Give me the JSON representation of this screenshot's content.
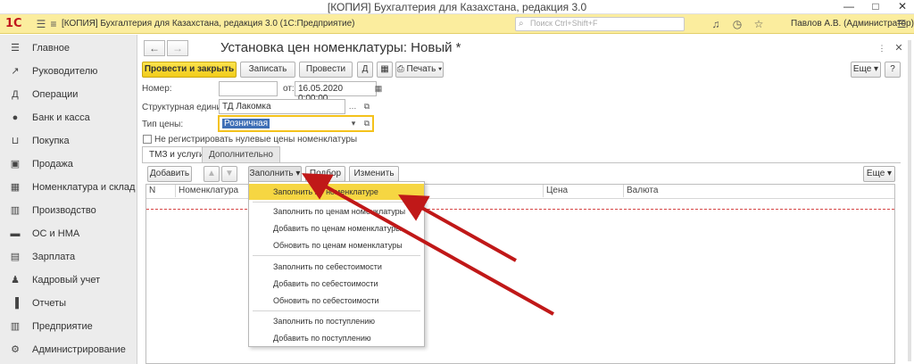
{
  "window": {
    "title": "[КОПИЯ] Бухгалтерия для Казахстана, редакция 3.0",
    "controls": [
      "—",
      "□",
      "✕"
    ]
  },
  "header": {
    "logo": "1С",
    "doc_title": "[КОПИЯ] Бухгалтерия для Казахстана, редакция 3.0  (1С:Предприятие)",
    "search_placeholder": "Поиск Ctrl+Shift+F",
    "user": "Павлов А.В. (Администратор)"
  },
  "sidebar": {
    "items": [
      {
        "label": "Главное",
        "icon": "menu-icon"
      },
      {
        "label": "Руководителю",
        "icon": "trend-icon"
      },
      {
        "label": "Операции",
        "icon": "operations-icon"
      },
      {
        "label": "Банк и касса",
        "icon": "bank-icon"
      },
      {
        "label": "Покупка",
        "icon": "cart-icon"
      },
      {
        "label": "Продажа",
        "icon": "bag-icon"
      },
      {
        "label": "Номенклатура и склад",
        "icon": "warehouse-icon"
      },
      {
        "label": "Производство",
        "icon": "factory-icon"
      },
      {
        "label": "ОС и НМА",
        "icon": "truck-icon"
      },
      {
        "label": "Зарплата",
        "icon": "salary-icon"
      },
      {
        "label": "Кадровый учет",
        "icon": "people-icon"
      },
      {
        "label": "Отчеты",
        "icon": "report-icon"
      },
      {
        "label": "Предприятие",
        "icon": "building-icon"
      },
      {
        "label": "Администрирование",
        "icon": "gear-icon"
      }
    ]
  },
  "form": {
    "title": "Установка цен номенклатуры: Новый *",
    "toolbar": {
      "post_close": "Провести и закрыть",
      "save": "Записать",
      "post": "Провести",
      "print": "Печать",
      "more": "Еще"
    },
    "fields": {
      "number_label": "Номер:",
      "number_value": "",
      "date_label": "от:",
      "date_value": "16.05.2020  0:00:00",
      "unit_label": "Структурная единица:",
      "unit_value": "ТД Лакомка",
      "price_type_label": "Тип цены:",
      "price_type_value": "Розничная",
      "no_zero_label": "Не регистрировать нулевые цены номенклатуры"
    },
    "tabs": [
      "ТМЗ и услуги",
      "Дополнительно"
    ],
    "table_toolbar": {
      "add": "Добавить",
      "fill": "Заполнить",
      "select": "Подбор",
      "change": "Изменить",
      "more": "Еще"
    },
    "columns": [
      "N",
      "Номенклатура",
      "Цена",
      "Валюта"
    ]
  },
  "fill_menu": {
    "items": [
      "Заполнить по номенклатуре",
      "Заполнить по ценам номенклатуры",
      "Добавить по ценам номенклатуры",
      "Обновить по ценам номенклатуры",
      "Заполнить по себестоимости",
      "Добавить по себестоимости",
      "Обновить по себестоимости",
      "Заполнить по поступлению",
      "Добавить по поступлению"
    ]
  },
  "colors": {
    "accent": "#f6d642",
    "arrow": "#c01818",
    "header": "#fbed9e"
  }
}
